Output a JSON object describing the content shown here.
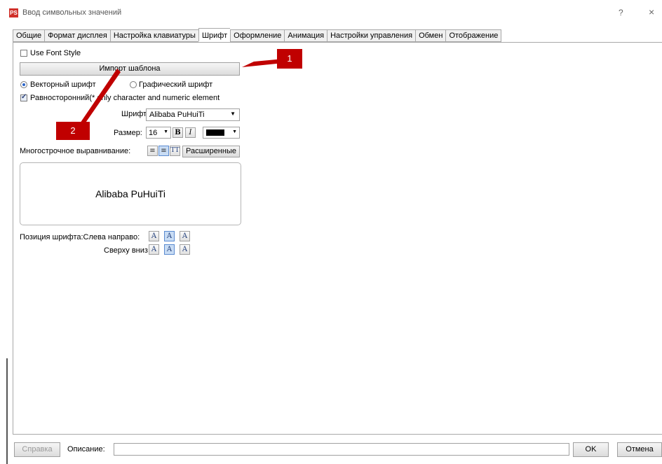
{
  "window": {
    "title": "Ввод символьных значений",
    "app_icon": "PS",
    "help": "?",
    "close": "×"
  },
  "tabs": [
    {
      "label": "Общие"
    },
    {
      "label": "Формат дисплея"
    },
    {
      "label": "Настройка клавиатуры"
    },
    {
      "label": "Шрифт",
      "active": true
    },
    {
      "label": "Оформление"
    },
    {
      "label": "Анимация"
    },
    {
      "label": "Настройки управления"
    },
    {
      "label": "Обмен"
    },
    {
      "label": "Отображение"
    }
  ],
  "font_tab": {
    "use_font_style": {
      "label": "Use Font Style",
      "checked": false
    },
    "import_template_label": "Импорт шаблона",
    "vector_font": {
      "label": "Векторный шрифт",
      "checked": true
    },
    "graphic_font": {
      "label": "Графический шрифт",
      "checked": false
    },
    "equal_width": {
      "label": "Равносторонний(* only character and numeric element",
      "checked": true
    },
    "font_label": "Шрифт:",
    "font_value": "Alibaba PuHuiTi",
    "size_label": "Размер:",
    "size_value": "16",
    "bold_label": "B",
    "italic_label": "I",
    "color": "#000000",
    "align_label": "Многострочное выравнивание:",
    "advanced_label": "Расширенные",
    "preview_text": "Alibaba PuHuiTi",
    "position_label": "Позиция шрифта:Слева направо:",
    "vertical_label": "Сверху вниз:",
    "pos_glyph": "A"
  },
  "annotations": {
    "callout_1": "1",
    "callout_2": "2",
    "color": "#c00000"
  },
  "bottom": {
    "help_label": "Справка",
    "description_label": "Описание:",
    "description_value": "",
    "ok_label": "OK",
    "cancel_label": "Отмена"
  }
}
